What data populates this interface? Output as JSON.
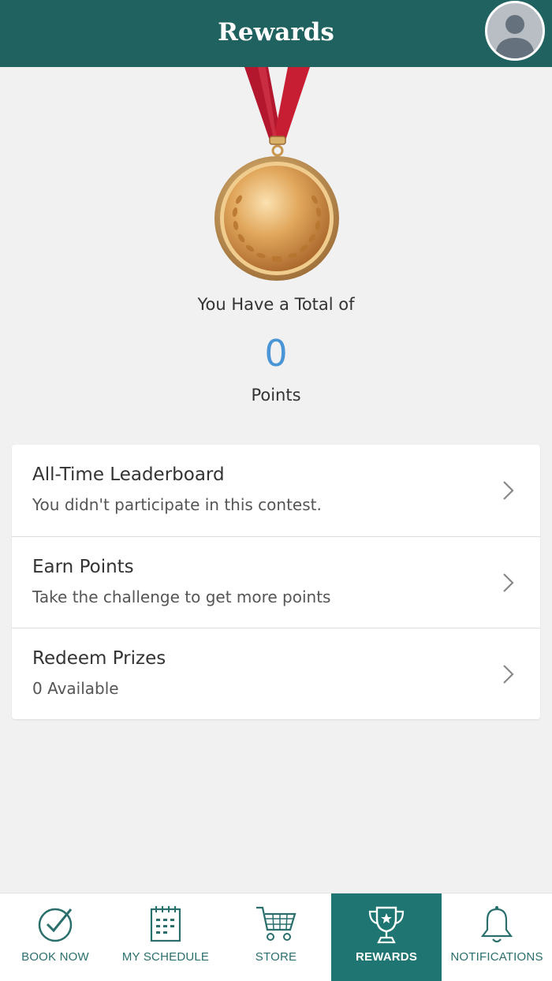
{
  "header": {
    "title": "Rewards",
    "avatar_icon": "user-avatar-icon"
  },
  "summary": {
    "total_label": "You Have a Total of",
    "points": "0",
    "points_label": "Points",
    "points_color": "#4a95d6"
  },
  "menu": [
    {
      "title": "All-Time Leaderboard",
      "subtitle": "You didn't participate in this contest."
    },
    {
      "title": "Earn Points",
      "subtitle": "Take the challenge to get more points"
    },
    {
      "title": "Redeem Prizes",
      "subtitle": "0 Available"
    }
  ],
  "tabs": [
    {
      "label": "BOOK NOW",
      "icon": "check-circle-icon",
      "active": false
    },
    {
      "label": "MY SCHEDULE",
      "icon": "calendar-icon",
      "active": false
    },
    {
      "label": "STORE",
      "icon": "cart-icon",
      "active": false
    },
    {
      "label": "REWARDS",
      "icon": "trophy-icon",
      "active": true
    },
    {
      "label": "NOTIFICATIONS",
      "icon": "bell-icon",
      "active": false
    }
  ],
  "colors": {
    "header": "#1f625f",
    "active_tab": "#1f7571",
    "tab_text": "#2a6f6c"
  }
}
